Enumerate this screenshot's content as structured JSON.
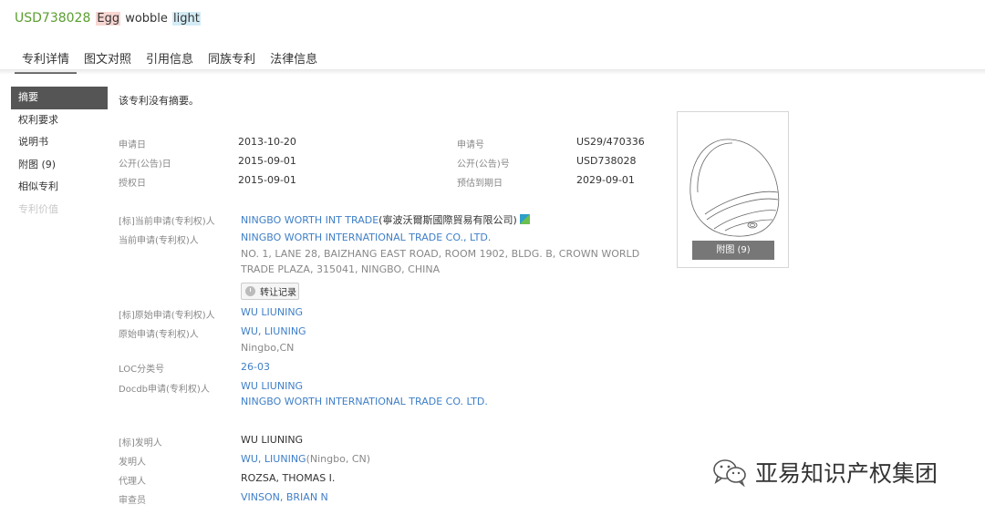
{
  "header": {
    "patent_no": "USD738028",
    "title_words": [
      "Egg",
      " wobble ",
      "light"
    ]
  },
  "tabs": [
    {
      "label": "专利详情",
      "active": true
    },
    {
      "label": "图文对照"
    },
    {
      "label": "引用信息"
    },
    {
      "label": "同族专利"
    },
    {
      "label": "法律信息"
    }
  ],
  "sidebar": [
    {
      "label": "摘要"
    },
    {
      "label": "权利要求"
    },
    {
      "label": "说明书"
    },
    {
      "label": "附图 (9)"
    },
    {
      "label": "相似专利"
    },
    {
      "label": "专利价值"
    }
  ],
  "abstract": "该专利没有摘要。",
  "fields": {
    "app_date_label": "申请日",
    "app_date": "2013-10-20",
    "app_no_label": "申请号",
    "app_no": "US29/470336",
    "pub_date_label": "公开(公告)日",
    "pub_date": "2015-09-01",
    "pub_no_label": "公开(公告)号",
    "pub_no": "USD738028",
    "grant_date_label": "授权日",
    "grant_date": "2015-09-01",
    "expiry_label": "预估到期日",
    "expiry": "2029-09-01",
    "std_cur_applicant_label": "[标]当前申请(专利权)人",
    "std_cur_applicant": "NINGBO WORTH INT TRADE",
    "std_cur_applicant_cn": "(寧波沃爾斯國際貿易有限公司)",
    "cur_applicant_label": "当前申请(专利权)人",
    "cur_applicant": "NINGBO WORTH INTERNATIONAL TRADE CO., LTD.",
    "cur_applicant_addr1": "NO. 1, LANE 28, BAIZHANG EAST ROAD, ROOM 1902, BLDG. B, CROWN WORLD",
    "cur_applicant_addr2": "TRADE PLAZA, 315041, NINGBO, CHINA",
    "transfer_button": "转让记录",
    "std_orig_applicant_label": "[标]原始申请(专利权)人",
    "std_orig_applicant": "WU LIUNING",
    "orig_applicant_label": "原始申请(专利权)人",
    "orig_applicant": "WU, LIUNING",
    "orig_applicant_loc": "Ningbo,CN",
    "loc_label": "LOC分类号",
    "loc": "26-03",
    "docdb_label": "Docdb申请(专利权)人",
    "docdb1": "WU LIUNING",
    "docdb2": "NINGBO WORTH INTERNATIONAL TRADE CO. LTD.",
    "std_inventor_label": "[标]发明人",
    "std_inventor": "WU LIUNING",
    "inventor_label": "发明人",
    "inventor": "WU, LIUNING",
    "inventor_loc": "(Ningbo, CN)",
    "agent_label": "代理人",
    "agent": "ROZSA, THOMAS I.",
    "examiner_label": "审查员",
    "examiner": "VINSON, BRIAN N"
  },
  "figure": {
    "caption": "附图 (9)"
  },
  "watermark": {
    "text": "亚易知识产权集团",
    "icon": "wechat-icon"
  }
}
